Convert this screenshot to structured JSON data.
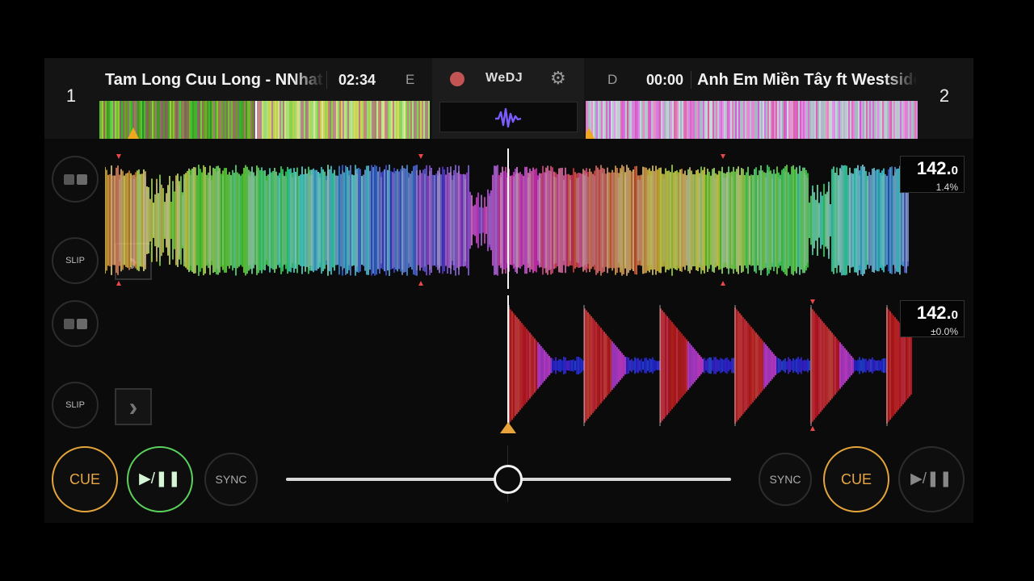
{
  "deck1": {
    "number": "1",
    "title": "Tam Long Cuu Long - NNhat Nam",
    "time": "02:34",
    "key": "E",
    "bpm_int": "142.",
    "bpm_dec": "0",
    "pitch": "1.4%",
    "slip_label": "SLIP",
    "cue_label": "CUE",
    "play_label": "▶/❚❚",
    "sync_label": "SYNC",
    "playing": true
  },
  "deck2": {
    "number": "2",
    "title": "Anh Em Miền Tây ft Westside",
    "time": "00:00",
    "key": "D",
    "bpm_int": "142.",
    "bpm_dec": "0",
    "pitch": "±0.0%",
    "slip_label": "SLIP",
    "cue_label": "CUE",
    "play_label": "▶/❚❚",
    "sync_label": "SYNC",
    "playing": false
  },
  "center": {
    "brand": "WeDJ",
    "record_icon": "record-icon",
    "settings_icon": "gear-icon",
    "waveform_icon": "waveform-icon"
  },
  "crossfader": {
    "position": 0.5
  },
  "colors": {
    "cue": "#e3a53a",
    "play_active": "#5ad15a",
    "record": "#c25454",
    "waveform_icon": "#7b5cff"
  }
}
